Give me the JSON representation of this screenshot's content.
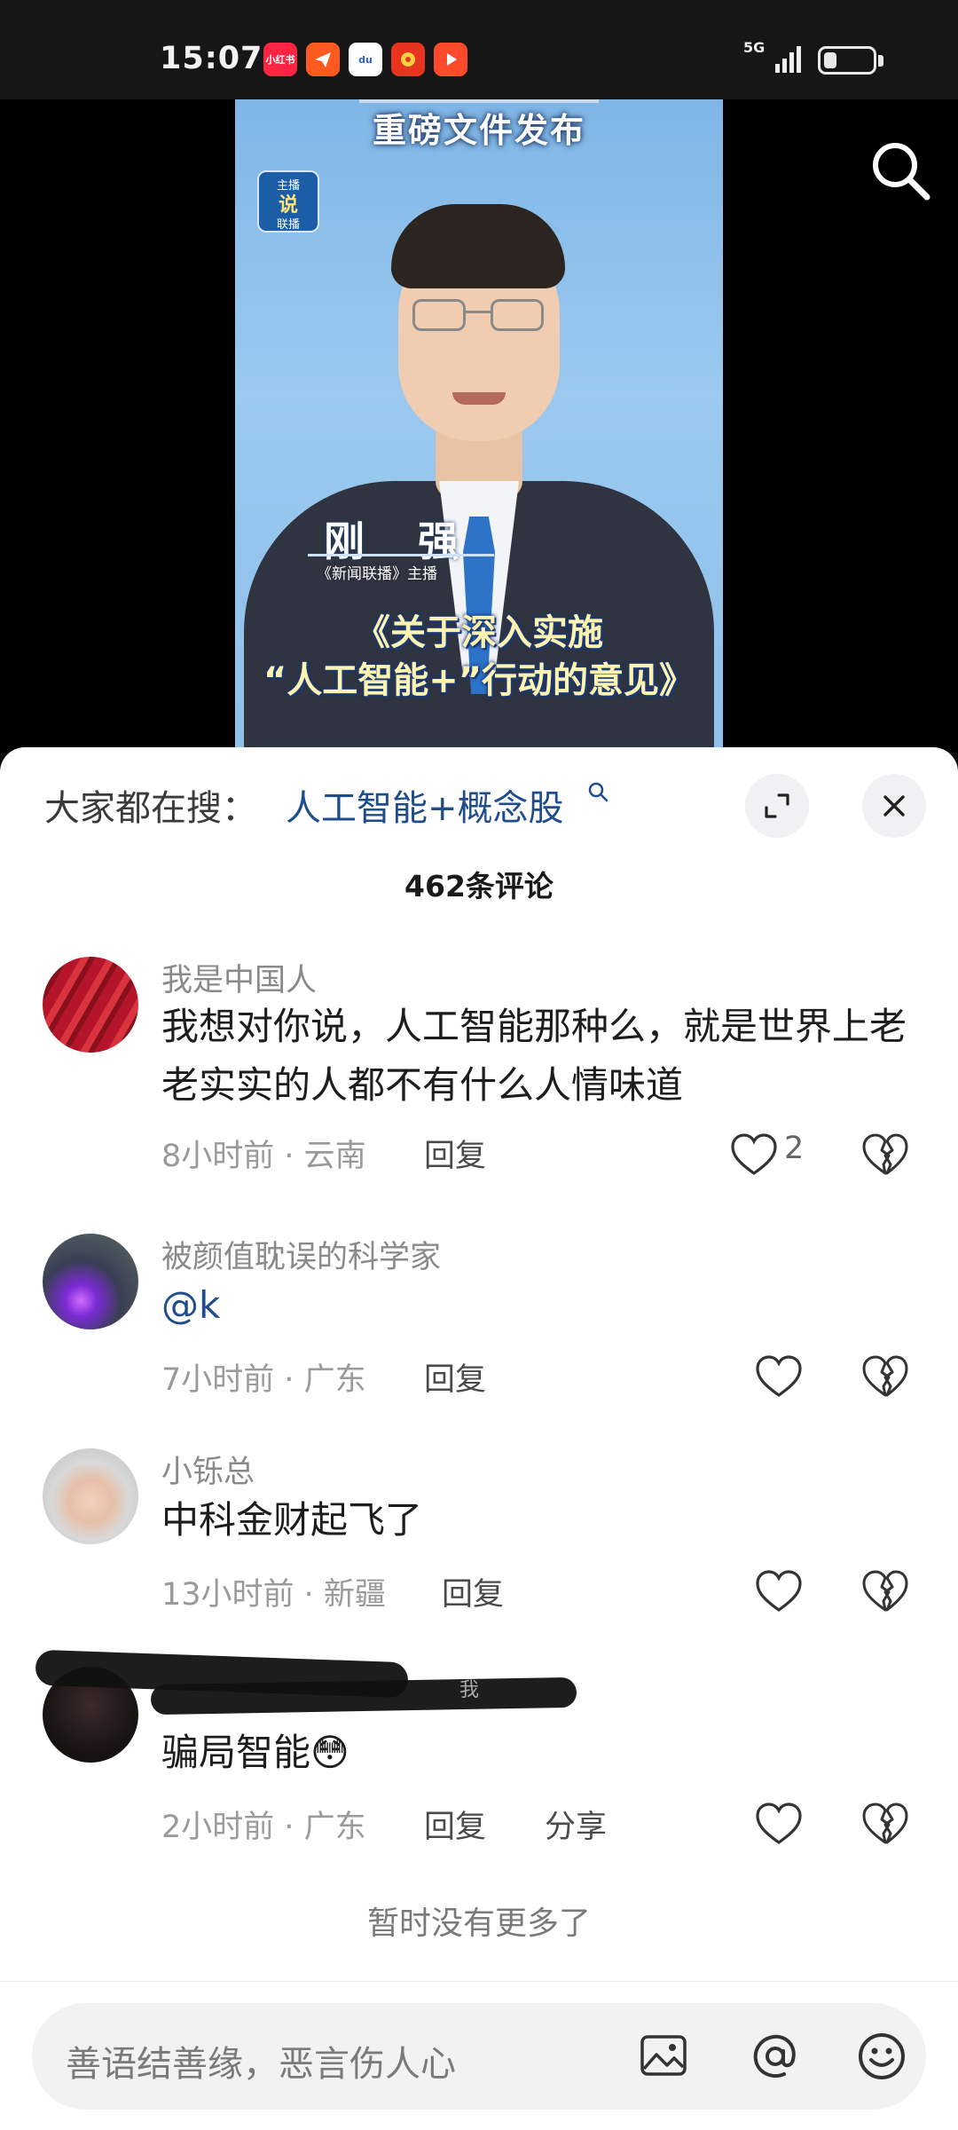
{
  "status_bar": {
    "time": "15:07",
    "network": "5G",
    "app_badges": [
      {
        "name": "xiaohongshu",
        "label": "小红书",
        "color": "#ff2442"
      },
      {
        "name": "telegram-style",
        "label": "",
        "color": "#ff5a1f"
      },
      {
        "name": "baidu",
        "label": "du",
        "color": "#ffffff"
      },
      {
        "name": "news",
        "label": "",
        "color": "#e8331e"
      },
      {
        "name": "video",
        "label": "",
        "color": "#ff4b2b"
      }
    ]
  },
  "video": {
    "top_title": "重磅文件发布",
    "station_logo": {
      "line1": "主播",
      "line2": "说",
      "line3": "联播"
    },
    "anchor_name": "刚 强",
    "anchor_role": "《新闻联播》主播",
    "caption_line1": "《关于深入实施",
    "caption_line2": "“人工智能+”行动的意见》"
  },
  "sheet": {
    "trend_prefix": "大家都在搜：",
    "trend_keyword": "人工智能+概念股",
    "comment_count": "462条评论",
    "comments": [
      {
        "username": "我是中国人",
        "text": "我想对你说，人工智能那种么，就是世界上老老实实的人都不有什么人情味道",
        "meta": "8小时前 · 云南",
        "reply": "回复",
        "likes": "2"
      },
      {
        "username": "被颜值耽误的科学家",
        "mention": "@k",
        "meta": "7小时前 · 广东",
        "reply": "回复"
      },
      {
        "username": "小铄总",
        "text": "中科金财起飞了",
        "meta": "13小时前 · 新疆",
        "reply": "回复"
      },
      {
        "username_tag": "我",
        "text": "骗局智能😳",
        "meta": "2小时前 · 广东",
        "reply": "回复",
        "share": "分享"
      }
    ],
    "no_more": "暂时没有更多了",
    "input_placeholder": "善语结善缘，恶言伤人心",
    "bar_icons": [
      "image-icon",
      "at-icon",
      "emoji-icon"
    ]
  }
}
